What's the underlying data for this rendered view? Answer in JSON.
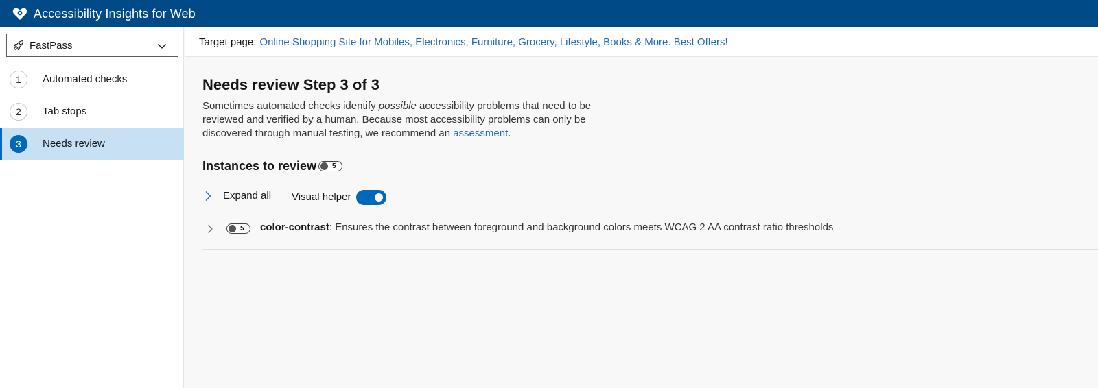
{
  "app": {
    "title": "Accessibility Insights for Web"
  },
  "icons": {
    "logo": "heart-logo-icon",
    "mode": "rocket-icon",
    "dropdown": "chevron-down-icon",
    "expand": "chevron-right-icon"
  },
  "colors": {
    "header_bg": "#004b87",
    "accent": "#0068b8",
    "active_nav_bg": "#c7e0f4",
    "link": "#1f6bb3"
  },
  "sidebar": {
    "mode_selector": {
      "value": "FastPass"
    },
    "items": [
      {
        "number": "1",
        "label": "Automated checks"
      },
      {
        "number": "2",
        "label": "Tab stops"
      },
      {
        "number": "3",
        "label": "Needs review",
        "active": true
      }
    ]
  },
  "target": {
    "label": "Target page:",
    "link_text": "Online Shopping Site for Mobiles, Electronics, Furniture, Grocery, Lifestyle, Books & More. Best Offers!"
  },
  "main": {
    "heading": "Needs review Step 3 of 3",
    "description": {
      "part1": "Sometimes automated checks identify ",
      "emphasis": "possible",
      "part2": " accessibility problems that need to be reviewed and verified by a human. Because most accessibility problems can only be discovered through manual testing, we recommend an ",
      "link": "assessment",
      "part3": "."
    },
    "instances": {
      "title": "Instances to review",
      "count": "5"
    },
    "expand_all_label": "Expand all",
    "visual_helper": {
      "label": "Visual helper",
      "enabled": true
    },
    "rules": [
      {
        "id": "color-contrast",
        "count": "5",
        "description": ": Ensures the contrast between foreground and background colors meets WCAG 2 AA contrast ratio thresholds"
      }
    ]
  }
}
